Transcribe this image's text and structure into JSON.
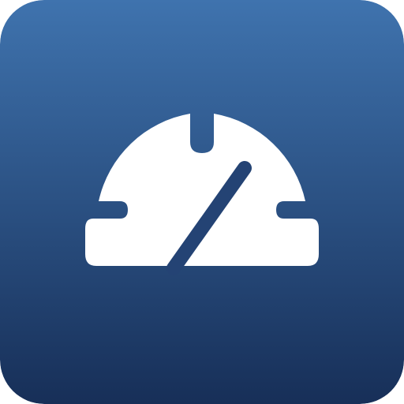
{
  "icon": {
    "name": "speedometer-icon",
    "colors": {
      "gradient_top": "#3F73AE",
      "gradient_bottom": "#172F58",
      "glyph": "#FFFFFF"
    }
  }
}
